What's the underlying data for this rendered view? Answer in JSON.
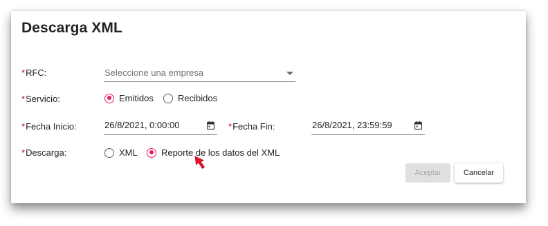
{
  "dialog": {
    "title": "Descarga XML"
  },
  "required_mark": "*",
  "rfc": {
    "label": "RFC:",
    "select_placeholder": "Seleccione una empresa",
    "caret_icon": "chevron-down-icon"
  },
  "servicio": {
    "label": "Servicio:",
    "options": [
      {
        "label": "Emitidos",
        "checked": true
      },
      {
        "label": "Recibidos",
        "checked": false
      }
    ]
  },
  "fecha_inicio": {
    "label": "Fecha Inicio:",
    "value": "26/8/2021, 0:00:00",
    "icon": "calendar-icon"
  },
  "fecha_fin": {
    "label": "Fecha Fin:",
    "value": "26/8/2021, 23:59:59",
    "icon": "calendar-icon"
  },
  "descarga": {
    "label": "Descarga:",
    "options": [
      {
        "label": "XML",
        "checked": false
      },
      {
        "label": "Reporte de los datos del XML",
        "checked": true
      }
    ]
  },
  "buttons": {
    "accept": "Aceptar",
    "accept_disabled": true,
    "cancel": "Cancelar"
  },
  "colors": {
    "accent": "#e91e63",
    "required": "#d0021b",
    "cursor": "#e8152a"
  }
}
